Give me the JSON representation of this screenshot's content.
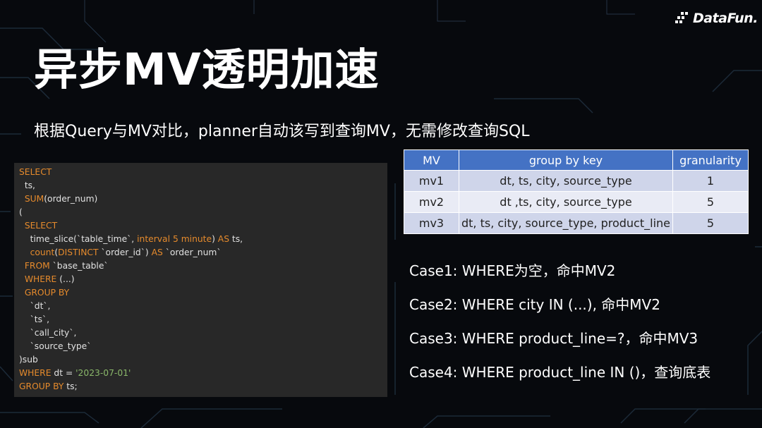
{
  "logo": {
    "text": "DataFun."
  },
  "title": "异步MV透明加速",
  "subtitle": "根据Query与MV对比，planner自动该写到查询MV，无需修改查询SQL",
  "code_lines": [
    [
      {
        "t": "SELECT",
        "c": "kw"
      }
    ],
    [
      {
        "t": "  ts,",
        "c": ""
      }
    ],
    [
      {
        "t": "  ",
        "c": ""
      },
      {
        "t": "SUM",
        "c": "kw"
      },
      {
        "t": "(order_num)",
        "c": ""
      }
    ],
    [
      {
        "t": "(",
        "c": ""
      }
    ],
    [
      {
        "t": "  ",
        "c": ""
      },
      {
        "t": "SELECT",
        "c": "kw"
      }
    ],
    [
      {
        "t": "    time_slice(`table_time`, ",
        "c": ""
      },
      {
        "t": "interval",
        "c": "kw"
      },
      {
        "t": " ",
        "c": ""
      },
      {
        "t": "5",
        "c": "num"
      },
      {
        "t": " ",
        "c": ""
      },
      {
        "t": "minute",
        "c": "kw"
      },
      {
        "t": ") ",
        "c": ""
      },
      {
        "t": "AS",
        "c": "kw"
      },
      {
        "t": " ts,",
        "c": ""
      }
    ],
    [
      {
        "t": "    ",
        "c": ""
      },
      {
        "t": "count",
        "c": "kw"
      },
      {
        "t": "(",
        "c": ""
      },
      {
        "t": "DISTINCT",
        "c": "kw"
      },
      {
        "t": " `order_id`) ",
        "c": ""
      },
      {
        "t": "AS",
        "c": "kw"
      },
      {
        "t": " `order_num`",
        "c": ""
      }
    ],
    [
      {
        "t": "  ",
        "c": ""
      },
      {
        "t": "FROM",
        "c": "kw"
      },
      {
        "t": " `base_table`",
        "c": ""
      }
    ],
    [
      {
        "t": "  ",
        "c": ""
      },
      {
        "t": "WHERE",
        "c": "kw"
      },
      {
        "t": " (...)",
        "c": ""
      }
    ],
    [
      {
        "t": "  ",
        "c": ""
      },
      {
        "t": "GROUP BY",
        "c": "kw"
      }
    ],
    [
      {
        "t": "    `dt`,",
        "c": ""
      }
    ],
    [
      {
        "t": "    `ts`,",
        "c": ""
      }
    ],
    [
      {
        "t": "    `call_city`,",
        "c": ""
      }
    ],
    [
      {
        "t": "    `source_type`",
        "c": ""
      }
    ],
    [
      {
        "t": ")sub",
        "c": ""
      }
    ],
    [
      {
        "t": "WHERE",
        "c": "kw"
      },
      {
        "t": " dt = ",
        "c": ""
      },
      {
        "t": "'2023-07-01'",
        "c": "str"
      }
    ],
    [
      {
        "t": "GROUP BY",
        "c": "kw"
      },
      {
        "t": " ts;",
        "c": ""
      }
    ]
  ],
  "table": {
    "headers": [
      "MV",
      "group by key",
      "granularity"
    ],
    "rows": [
      [
        "mv1",
        "dt, ts, city, source_type",
        "1"
      ],
      [
        "mv2",
        "dt ,ts, city, source_type",
        "5"
      ],
      [
        "mv3",
        "dt, ts, city, source_type, product_line",
        "5"
      ]
    ]
  },
  "cases": [
    "Case1: WHERE为空，命中MV2",
    "Case2: WHERE city IN (...), 命中MV2",
    "Case3: WHERE product_line=?，命中MV3",
    "Case4: WHERE product_line IN ()，查询底表"
  ],
  "colors": {
    "keyword": "#e58a2c",
    "string": "#8ab86a",
    "table_header": "#4472c4"
  }
}
